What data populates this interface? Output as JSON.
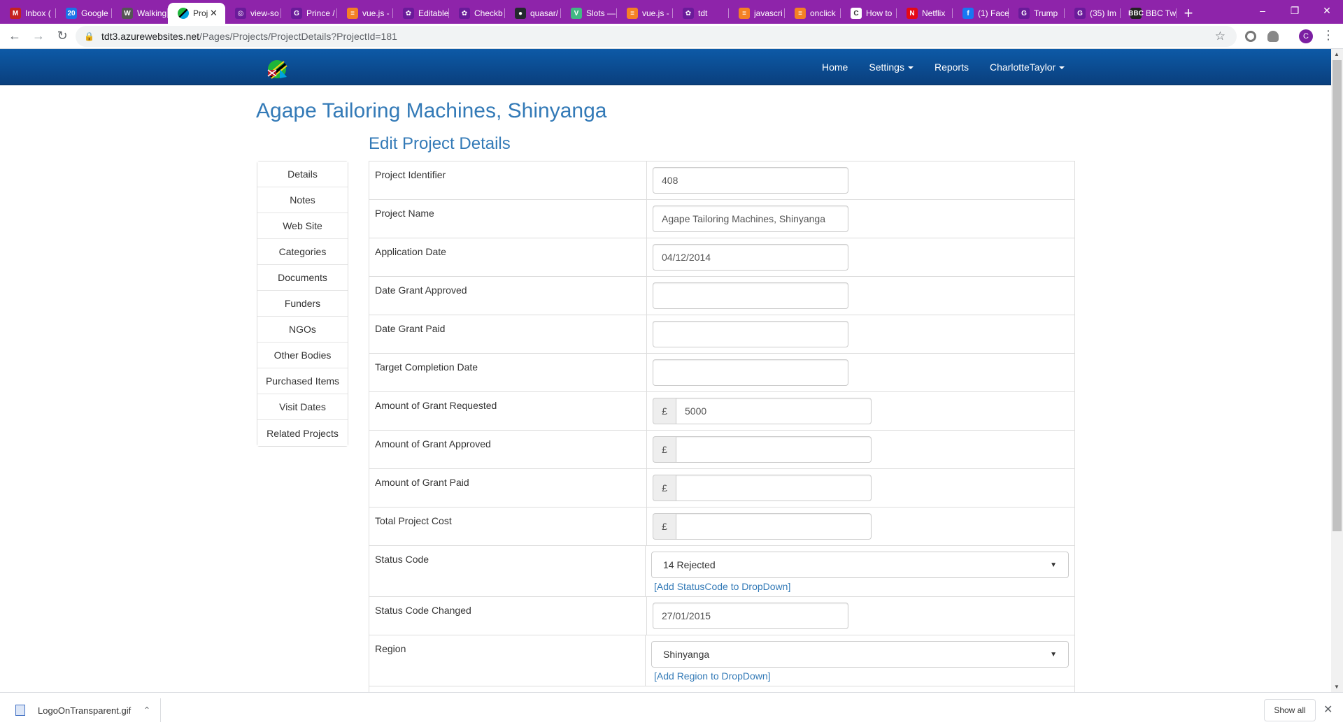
{
  "browser": {
    "tabs": [
      {
        "title": "Inbox (",
        "icon": "gmail-icon",
        "color": "#c5221f",
        "glyph": "M"
      },
      {
        "title": "Google",
        "icon": "calendar-icon",
        "color": "#1a73e8",
        "glyph": "20"
      },
      {
        "title": "Walking",
        "icon": "wikipedia-icon",
        "color": "#555555",
        "glyph": "W"
      },
      {
        "title": "Proj",
        "icon": "tanzania-flag-icon",
        "color": "#1eb53a",
        "glyph": "",
        "active": true
      },
      {
        "title": "view-so",
        "icon": "github-icon",
        "color": "#6a1b9a",
        "glyph": "◎"
      },
      {
        "title": "Prince /",
        "icon": "g-icon",
        "color": "#6a1b9a",
        "glyph": "G"
      },
      {
        "title": "vue.js -",
        "icon": "stackoverflow-icon",
        "color": "#f48024",
        "glyph": "≡"
      },
      {
        "title": "Editable",
        "icon": "chatgpt-icon",
        "color": "#6a1b9a",
        "glyph": "✿"
      },
      {
        "title": "Checkb",
        "icon": "chatgpt-icon",
        "color": "#6a1b9a",
        "glyph": "✿"
      },
      {
        "title": "quasar/",
        "icon": "github-icon",
        "color": "#24292e",
        "glyph": "●"
      },
      {
        "title": "Slots —",
        "icon": "vue-icon",
        "color": "#41b883",
        "glyph": "V"
      },
      {
        "title": "vue.js -",
        "icon": "stackoverflow-icon",
        "color": "#f48024",
        "glyph": "≡"
      },
      {
        "title": "tdt",
        "icon": "chatgpt-icon",
        "color": "#6a1b9a",
        "glyph": "✿"
      },
      {
        "title": "javascri",
        "icon": "stackoverflow-icon",
        "color": "#f48024",
        "glyph": "≡"
      },
      {
        "title": "onclick",
        "icon": "stackoverflow-icon",
        "color": "#f48024",
        "glyph": "≡"
      },
      {
        "title": "How to",
        "icon": "c-icon",
        "color": "#ffffff",
        "glyph": "C"
      },
      {
        "title": "Netflix",
        "icon": "netflix-icon",
        "color": "#e50914",
        "glyph": "N"
      },
      {
        "title": "(1) Face",
        "icon": "facebook-icon",
        "color": "#1877f2",
        "glyph": "f"
      },
      {
        "title": "Trump",
        "icon": "g-icon",
        "color": "#6a1b9a",
        "glyph": "G"
      },
      {
        "title": "(35) Im",
        "icon": "g-icon",
        "color": "#6a1b9a",
        "glyph": "G"
      },
      {
        "title": "BBC Tw",
        "icon": "bbc-icon",
        "color": "#222222",
        "glyph": "BBC"
      }
    ],
    "url_host": "tdt3.azurewebsites.net",
    "url_path": "/Pages/Projects/ProjectDetails?ProjectId=181",
    "profile_initial": "C"
  },
  "nav": {
    "home": "Home",
    "settings": "Settings",
    "reports": "Reports",
    "user": "CharlotteTaylor"
  },
  "page": {
    "title": "Agape Tailoring Machines, Shinyanga",
    "section_title": "Edit Project Details"
  },
  "side_menu": [
    "Details",
    "Notes",
    "Web Site",
    "Categories",
    "Documents",
    "Funders",
    "NGOs",
    "Other Bodies",
    "Purchased Items",
    "Visit Dates",
    "Related Projects"
  ],
  "form": {
    "project_identifier": {
      "label": "Project Identifier",
      "value": "408"
    },
    "project_name": {
      "label": "Project Name",
      "value": "Agape Tailoring Machines, Shinyanga"
    },
    "application_date": {
      "label": "Application Date",
      "value": "04/12/2014"
    },
    "date_grant_approved": {
      "label": "Date Grant Approved",
      "value": ""
    },
    "date_grant_paid": {
      "label": "Date Grant Paid",
      "value": ""
    },
    "target_completion_date": {
      "label": "Target Completion Date",
      "value": ""
    },
    "currency_symbol": "£",
    "amount_requested": {
      "label": "Amount of Grant Requested",
      "value": "5000"
    },
    "amount_approved": {
      "label": "Amount of Grant Approved",
      "value": ""
    },
    "amount_paid": {
      "label": "Amount of Grant Paid",
      "value": ""
    },
    "total_cost": {
      "label": "Total Project Cost",
      "value": ""
    },
    "status_code": {
      "label": "Status Code",
      "value": "14 Rejected",
      "add_link": "[Add StatusCode to DropDown]"
    },
    "status_code_changed": {
      "label": "Status Code Changed",
      "value": "27/01/2015"
    },
    "region": {
      "label": "Region",
      "value": "Shinyanga",
      "add_link": "[Add Region to DropDown]"
    }
  },
  "downloads": {
    "file": "LogoOnTransparent.gif",
    "show_all": "Show all"
  },
  "colors": {
    "tabstrip": "#8e24aa",
    "navbar": "#0a4c92",
    "heading": "#337ab7"
  }
}
